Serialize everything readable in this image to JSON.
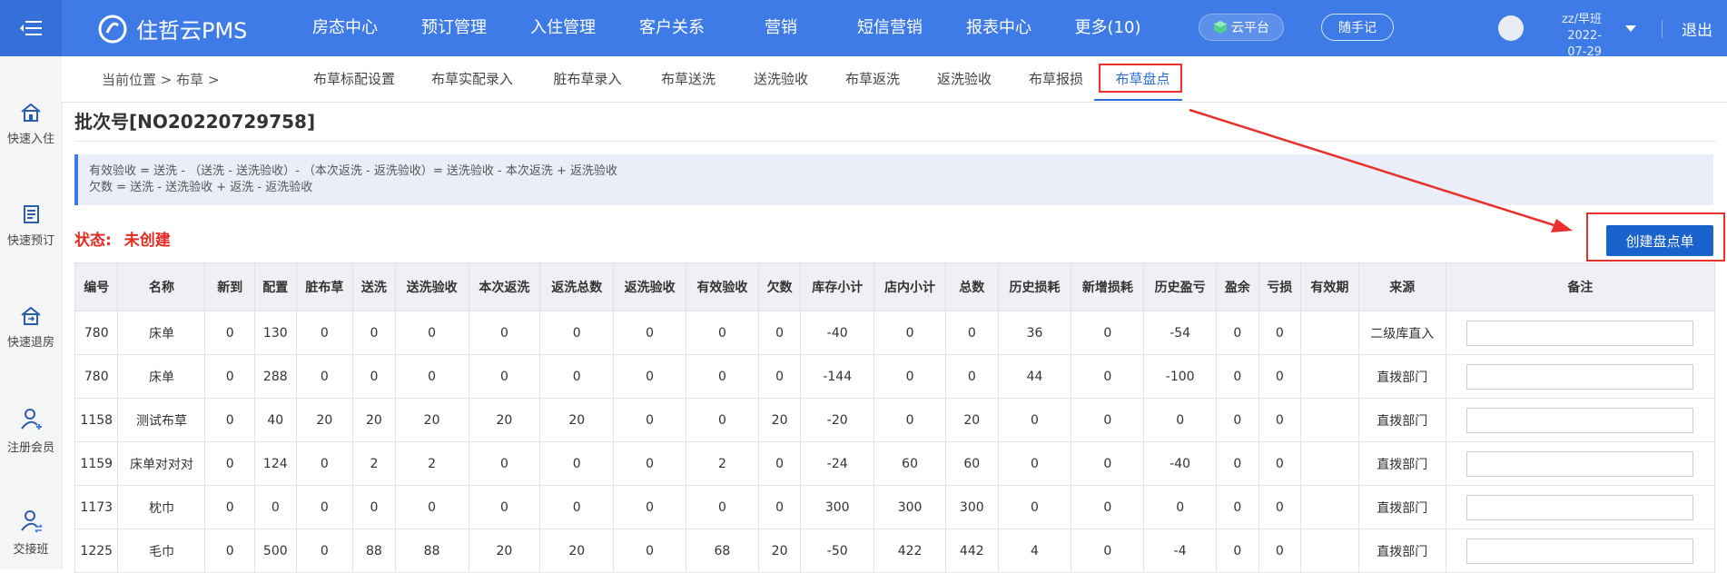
{
  "app": {
    "name": "住哲云PMS"
  },
  "nav": [
    "房态中心",
    "预订管理",
    "入住管理",
    "客户关系",
    "营销",
    "短信营销",
    "报表中心",
    "更多(10)"
  ],
  "header": {
    "cloud_label": "云平台",
    "note_label": "随手记",
    "user_line1": "zz/早班2022-",
    "user_line2": "07-29",
    "logout": "退出"
  },
  "sidebar": [
    {
      "label": "快速入住",
      "icon": "home-icon"
    },
    {
      "label": "快速预订",
      "icon": "booking-icon"
    },
    {
      "label": "快速退房",
      "icon": "checkout-icon"
    },
    {
      "label": "注册会员",
      "icon": "member-add-icon"
    },
    {
      "label": "交接班",
      "icon": "shift-handover-icon"
    }
  ],
  "breadcrumb": {
    "location": "当前位置",
    "sep1": ">",
    "section": "布草",
    "sep2": ">"
  },
  "tabs": [
    "布草标配设置",
    "布草实配录入",
    "脏布草录入",
    "布草送洗",
    "送洗验收",
    "布草返洗",
    "返洗验收",
    "布草报损",
    "布草盘点"
  ],
  "active_tab": "布草盘点",
  "batch": "批次号[NO20220729758]",
  "formula": {
    "line1": "有效验收 = 送洗 - （送洗 - 送洗验收）- （本次返洗 - 返洗验收）= 送洗验收 - 本次返洗 + 返洗验收",
    "line2": "欠数 = 送洗 - 送洗验收 + 返洗 - 返洗验收"
  },
  "status": {
    "label": "状态:",
    "value": "未创建"
  },
  "create_button": "创建盘点单",
  "table": {
    "headers": [
      "编号",
      "名称",
      "新到",
      "配置",
      "脏布草",
      "送洗",
      "送洗验收",
      "本次返洗",
      "返洗总数",
      "返洗验收",
      "有效验收",
      "欠数",
      "库存小计",
      "店内小计",
      "总数",
      "历史损耗",
      "新增损耗",
      "历史盈亏",
      "盈余",
      "亏损",
      "有效期",
      "来源",
      "备注"
    ],
    "rows": [
      [
        "780",
        "床单",
        "0",
        "130",
        "0",
        "0",
        "0",
        "0",
        "0",
        "0",
        "0",
        "0",
        "-40",
        "0",
        "0",
        "36",
        "0",
        "-54",
        "0",
        "0",
        "",
        "二级库直入"
      ],
      [
        "780",
        "床单",
        "0",
        "288",
        "0",
        "0",
        "0",
        "0",
        "0",
        "0",
        "0",
        "0",
        "-144",
        "0",
        "0",
        "44",
        "0",
        "-100",
        "0",
        "0",
        "",
        "直拨部门"
      ],
      [
        "1158",
        "测试布草",
        "0",
        "40",
        "20",
        "20",
        "20",
        "20",
        "20",
        "0",
        "0",
        "20",
        "-20",
        "0",
        "20",
        "0",
        "0",
        "0",
        "0",
        "0",
        "",
        "直拨部门"
      ],
      [
        "1159",
        "床单对对对",
        "0",
        "124",
        "0",
        "2",
        "2",
        "0",
        "0",
        "0",
        "2",
        "0",
        "-24",
        "60",
        "60",
        "0",
        "0",
        "-40",
        "0",
        "0",
        "",
        "直拨部门"
      ],
      [
        "1173",
        "枕巾",
        "0",
        "0",
        "0",
        "0",
        "0",
        "0",
        "0",
        "0",
        "0",
        "0",
        "300",
        "300",
        "300",
        "0",
        "0",
        "0",
        "0",
        "0",
        "",
        "直拨部门"
      ],
      [
        "1225",
        "毛巾",
        "0",
        "500",
        "0",
        "88",
        "88",
        "20",
        "20",
        "0",
        "68",
        "20",
        "-50",
        "422",
        "442",
        "4",
        "0",
        "-4",
        "0",
        "0",
        "",
        "直拨部门"
      ]
    ]
  },
  "colors": {
    "primary": "#3e7be6",
    "accent_red": "#e8312b",
    "button_blue": "#1a63cc"
  }
}
